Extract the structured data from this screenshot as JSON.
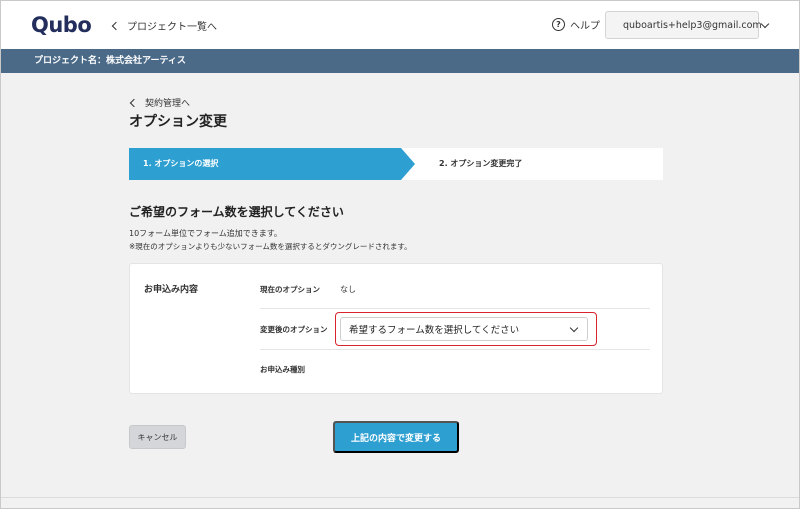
{
  "header": {
    "logo": "Qubo",
    "back_link": "プロジェクト一覧へ",
    "help_label": "ヘルプ",
    "help_icon": "?",
    "account_email": "quboartis+help3@gmail.com"
  },
  "project_bar": {
    "text": "プロジェクト名：株式会社アーティス"
  },
  "main": {
    "breadcrumb": "契約管理へ",
    "title": "オプション変更",
    "steps": [
      {
        "label": "1. オプションの選択",
        "active": true
      },
      {
        "label": "2. オプション変更完了",
        "active": false
      }
    ],
    "section_title": "ご希望のフォーム数を選択してください",
    "description_1": "10フォーム単位でフォーム追加できます。",
    "description_2": "※現在のオプションよりも少ないフォーム数を選択するとダウングレードされます。"
  },
  "card": {
    "label": "お申込み内容",
    "current_option_label": "現在のオプション",
    "current_option_value": "なし",
    "new_option_label": "変更後のオプション",
    "new_option_select": "希望するフォーム数を選択してください",
    "application_type_label": "お申込み種別"
  },
  "actions": {
    "cancel_label": "キャンセル",
    "submit_label": "上記の内容で変更する"
  },
  "colors": {
    "accent": "#2d9fd1",
    "project_bar": "#4b6a88",
    "highlight": "#d9232d",
    "logo": "#232e5c"
  }
}
